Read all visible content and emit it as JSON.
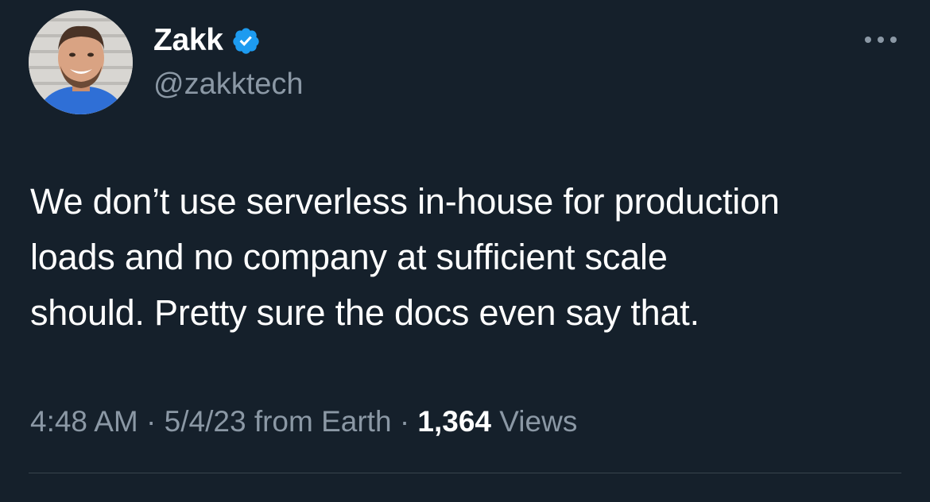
{
  "author": {
    "display_name": "Zakk",
    "handle": "@zakktech",
    "avatar_icon": "profile-photo",
    "verified_icon": "verified-badge-icon"
  },
  "tweet": {
    "text_lines": [
      "We don’t use serverless in-house for production",
      "loads and no company at sufficient scale",
      "should. Pretty sure the docs even say that."
    ]
  },
  "meta": {
    "time": "4:48 AM",
    "separator": "·",
    "date": "5/4/23",
    "source": "from Earth",
    "views_count": "1,364",
    "views_label": "Views"
  },
  "colors": {
    "background": "#15202b",
    "text": "#ffffff",
    "secondary_text": "#8b98a5",
    "verified_blue": "#1d9bf0",
    "divider": "#38444d"
  }
}
